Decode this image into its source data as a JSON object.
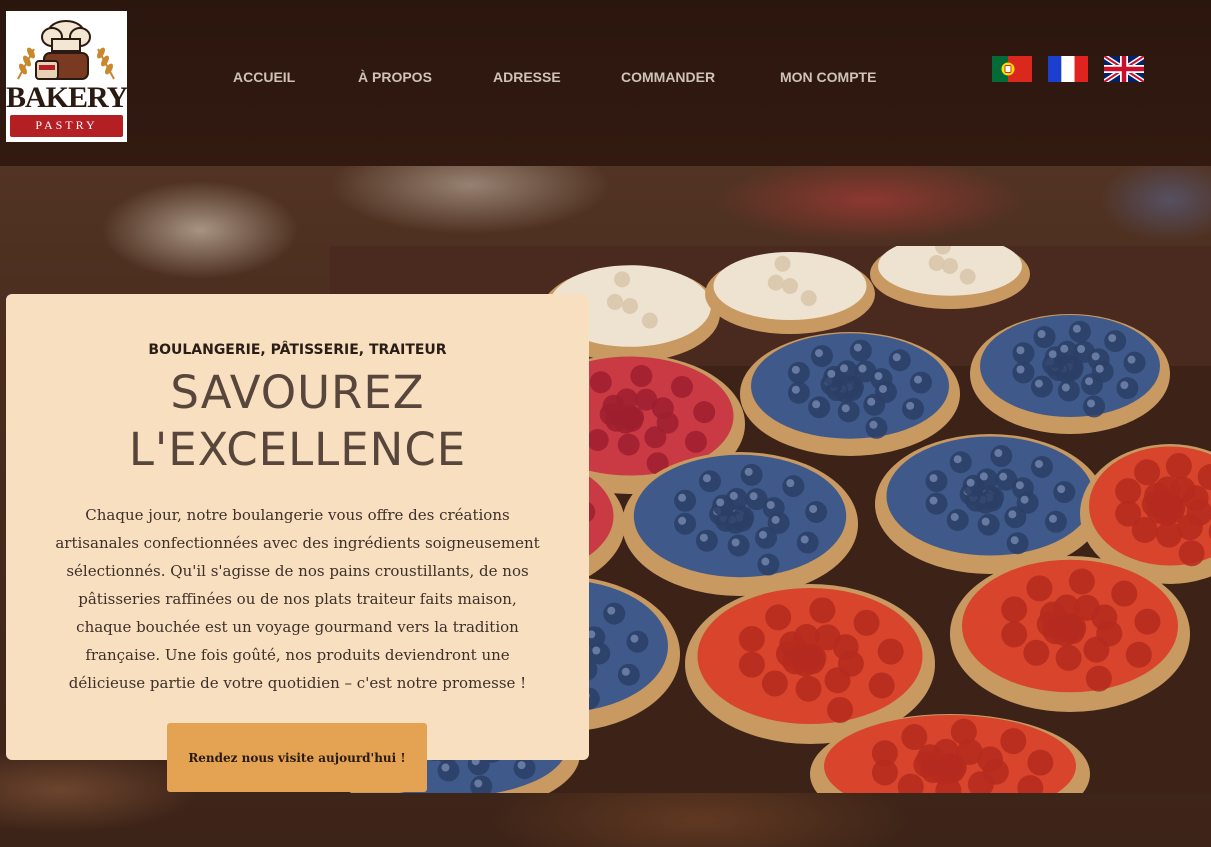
{
  "logo": {
    "word": "BAKERY",
    "sub": "PASTRY",
    "colors": {
      "ribbon": "#b41f24",
      "ink": "#2a1a12"
    }
  },
  "nav": {
    "items": [
      {
        "label": "ACCUEIL"
      },
      {
        "label": "À PROPOS"
      },
      {
        "label": "ADRESSE"
      },
      {
        "label": "COMMANDER"
      },
      {
        "label": "MON COMPTE"
      }
    ]
  },
  "languages": [
    {
      "name": "portugal-flag",
      "lang": "pt"
    },
    {
      "name": "france-flag",
      "lang": "fr"
    },
    {
      "name": "uk-flag",
      "lang": "en"
    }
  ],
  "hero": {
    "tagline": "BOULANGERIE, PÂTISSERIE, TRAITEUR",
    "headline_line1": "SAVOUREZ",
    "headline_line2": "L'EXCELLENCE",
    "description": "Chaque jour, notre boulangerie vous offre des créations artisanales confectionnées avec des ingrédients soigneusement sélectionnés. Qu'il s'agisse de nos pains croustillants, de nos pâtisseries raffinées ou de nos plats traiteur faits maison, chaque bouchée est un voyage gourmand vers la tradition française. Une fois goûté, nos produits deviendront une délicieuse partie de votre quotidien – c'est notre promesse !",
    "cta_label": "Rendez nous visite aujourd'hui !"
  },
  "colors": {
    "header_bg": "#2b160e",
    "card_bg": "#f7dfc0",
    "cta_bg": "#e3a352",
    "nav_text": "#cfc2b6"
  }
}
